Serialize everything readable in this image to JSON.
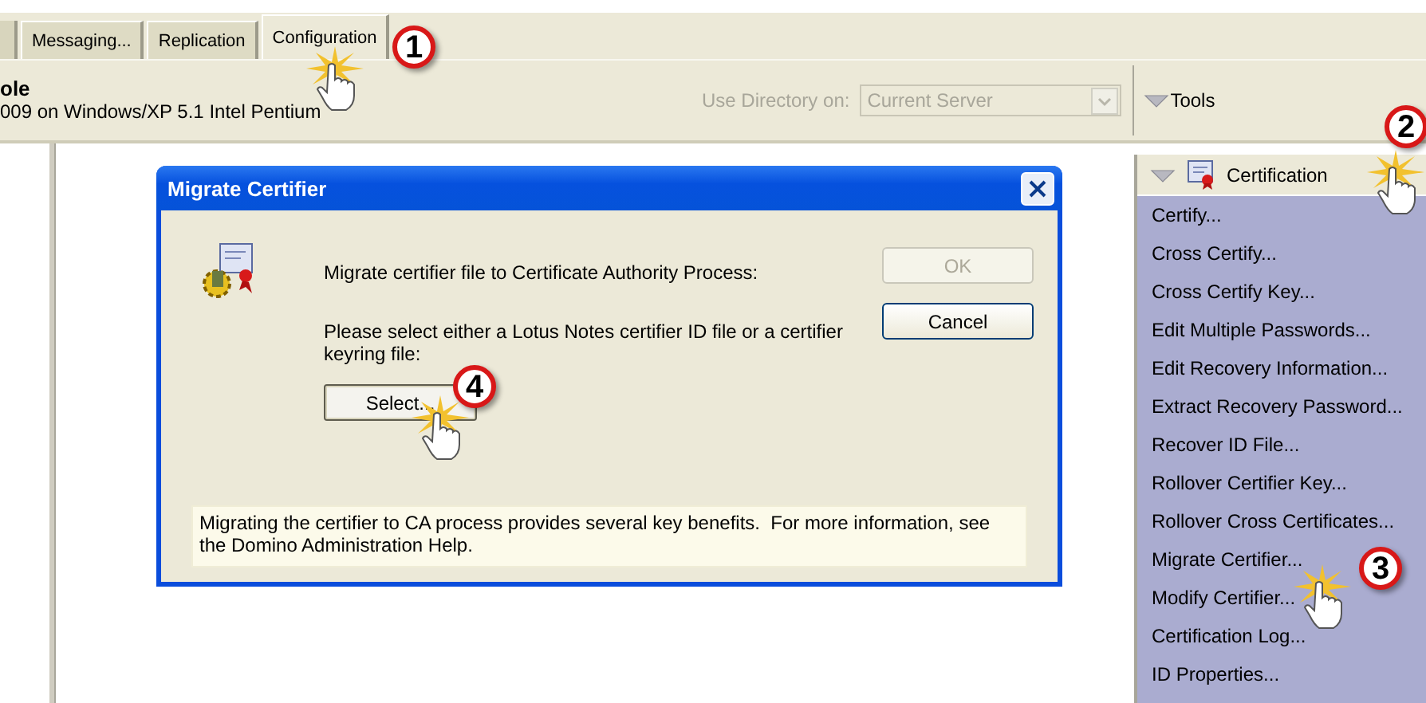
{
  "tabs": [
    {
      "label": "Messaging...",
      "selected": false
    },
    {
      "label": "Replication",
      "selected": false
    },
    {
      "label": "Configuration",
      "selected": true
    }
  ],
  "server": {
    "name": "ole",
    "info": "009 on Windows/XP 5.1 Intel Pentium"
  },
  "directory": {
    "label": "Use Directory on:",
    "value": "Current Server",
    "disabled": true
  },
  "tools": {
    "label": "Tools",
    "expanded": true
  },
  "tools_panel": {
    "section": {
      "label": "Certification",
      "expanded": true
    },
    "items": [
      "Certify...",
      "Cross Certify...",
      "Cross Certify Key...",
      "Edit Multiple Passwords...",
      "Edit Recovery Information...",
      "Extract Recovery Password...",
      "Recover ID File...",
      "Rollover Certifier Key...",
      "Rollover Cross Certificates...",
      "Migrate Certifier...",
      "Modify Certifier...",
      "Certification Log...",
      "ID Properties..."
    ]
  },
  "dialog": {
    "title": "Migrate Certifier",
    "message": "Migrate certifier file to Certificate Authority Process:",
    "instruction": "Please select either a Lotus Notes certifier ID file or a certifier keyring file:",
    "select_button": "Select...",
    "buttons": [
      {
        "label": "OK",
        "disabled": true
      },
      {
        "label": "Cancel",
        "disabled": false
      }
    ],
    "info": "Migrating the certifier to CA process provides several key benefits.  For more information, see the Domino Administration Help."
  },
  "callouts": [
    {
      "label": "1"
    },
    {
      "label": "2"
    },
    {
      "label": "3"
    },
    {
      "label": "4"
    }
  ]
}
